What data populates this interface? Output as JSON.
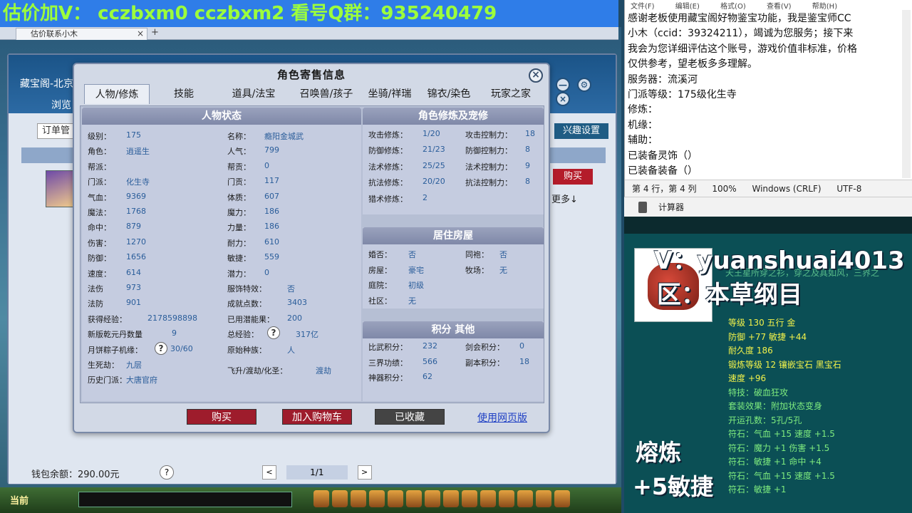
{
  "banner": {
    "text": "估价加V：  cczbxm0   cczbxm2   看号Q群：935240479"
  },
  "browser": {
    "tab_label": "估价联系小木",
    "close_glyph": "×",
    "add_glyph": "+"
  },
  "bg_window": {
    "title": "藏宝阁-北京",
    "browse": "浏览",
    "order_btn": "订单管",
    "interest_btn": "兴趣设置",
    "buy_btn": "购买",
    "more_btn": "更多↓",
    "wallet": "钱包余额：290.00元",
    "help": "?",
    "pager": {
      "prev": "<",
      "page": "1/1",
      "next": ">"
    },
    "ctrl": {
      "minimize": "—",
      "settings": "⚙",
      "close": "×"
    }
  },
  "taskbar": {
    "current": "当前"
  },
  "dialog": {
    "title": "角色寄售信息",
    "close": "×",
    "tabs": [
      "人物/修炼",
      "技能",
      "道具/法宝",
      "召唤兽/孩子",
      "坐骑/祥瑞",
      "锦衣/染色",
      "玩家之家"
    ],
    "sections": {
      "status": "人物状态",
      "cultivation": "角色修炼及宠修",
      "housing": "居住房屋",
      "points": "积分 其他"
    },
    "status_left": [
      {
        "k": "级别：",
        "v": "175"
      },
      {
        "k": "角色：",
        "v": "逍遥生"
      },
      {
        "k": "帮派：",
        "v": ""
      },
      {
        "k": "门派：",
        "v": "化生寺"
      },
      {
        "k": "气血：",
        "v": "9369"
      },
      {
        "k": "魔法：",
        "v": "1768"
      },
      {
        "k": "命中：",
        "v": "879"
      },
      {
        "k": "伤害：",
        "v": "1270"
      },
      {
        "k": "防御：",
        "v": "1656"
      },
      {
        "k": "速度：",
        "v": "614"
      },
      {
        "k": "法伤",
        "v": "973"
      },
      {
        "k": "法防",
        "v": "901"
      },
      {
        "k": "获得经验：",
        "v": "2178598898"
      },
      {
        "k": "新版乾元丹数量",
        "v": "9"
      },
      {
        "k": "月饼粽子机缘：",
        "v": "30/60"
      },
      {
        "k": "生死劫：",
        "v": "九层"
      },
      {
        "k": "历史门派：",
        "v": "大唐官府"
      }
    ],
    "status_right": [
      {
        "k": "名称：",
        "v": "瘾阳金城武"
      },
      {
        "k": "人气：",
        "v": "799"
      },
      {
        "k": "帮贡：",
        "v": "0"
      },
      {
        "k": "门贡：",
        "v": "117"
      },
      {
        "k": "体质：",
        "v": "607"
      },
      {
        "k": "魔力：",
        "v": "186"
      },
      {
        "k": "力量：",
        "v": "186"
      },
      {
        "k": "耐力：",
        "v": "610"
      },
      {
        "k": "敏捷：",
        "v": "559"
      },
      {
        "k": "潜力：",
        "v": "0"
      },
      {
        "k": "服饰特效：",
        "v": "否"
      },
      {
        "k": "成就点数：",
        "v": "3403"
      },
      {
        "k": "已用潜能果：",
        "v": "200"
      },
      {
        "k": "总经验：",
        "v": "317亿"
      },
      {
        "k": "原始种族：",
        "v": "人"
      },
      {
        "k": "飞升/渡劫/化圣：",
        "v": "渡劫"
      }
    ],
    "question": "?",
    "cultivation_left": [
      {
        "k": "攻击修炼：",
        "v": "1/20"
      },
      {
        "k": "防御修炼：",
        "v": "21/23"
      },
      {
        "k": "法术修炼：",
        "v": "25/25"
      },
      {
        "k": "抗法修炼：",
        "v": "20/20"
      },
      {
        "k": "猎术修炼：",
        "v": "2"
      }
    ],
    "cultivation_right": [
      {
        "k": "攻击控制力：",
        "v": "18"
      },
      {
        "k": "防御控制力：",
        "v": "8"
      },
      {
        "k": "法术控制力：",
        "v": "9"
      },
      {
        "k": "抗法控制力：",
        "v": "8"
      }
    ],
    "housing_left": [
      {
        "k": "婚否：",
        "v": "否"
      },
      {
        "k": "房屋：",
        "v": "豪宅"
      },
      {
        "k": "庭院：",
        "v": "初级"
      },
      {
        "k": "社区：",
        "v": "无"
      }
    ],
    "housing_right": [
      {
        "k": "同袍：",
        "v": "否"
      },
      {
        "k": "牧场：",
        "v": "无"
      }
    ],
    "points_left": [
      {
        "k": "比武积分：",
        "v": "232"
      },
      {
        "k": "三界功绩：",
        "v": "566"
      },
      {
        "k": "神器积分：",
        "v": "62"
      }
    ],
    "points_right": [
      {
        "k": "剑会积分：",
        "v": "0"
      },
      {
        "k": "副本积分：",
        "v": "18"
      }
    ],
    "buttons": {
      "buy": "购买",
      "cart": "加入购物车",
      "saved": "已收藏",
      "web": "使用网页版"
    }
  },
  "notepad": {
    "menu": [
      "文件(F)",
      "编辑(E)",
      "格式(O)",
      "查看(V)",
      "帮助(H)"
    ],
    "lines": [
      "感谢老板使用藏宝阁好物鉴宝功能，我是鉴宝师CC",
      "小木（ccid：39324211），竭诚为您服务；接下来",
      "我会为您详细评估这个账号，游戏价值非标准，价格",
      "仅供参考，望老板多多理解。",
      "服务器：流溪河",
      "门派等级：175级化生寺",
      "修炼：",
      "机缘：",
      "辅助：",
      "已装备灵饰（）",
      "已装备装备（）"
    ],
    "status": [
      "第 4 行，第 4 列",
      "100%",
      "Windows (CRLF)",
      "UTF-8"
    ]
  },
  "calculator": {
    "label": "计算器"
  },
  "item": {
    "overlay_v": "V：yuanshuai4013",
    "overlay_zone": "区：本草纲目",
    "desc": "天王星所穿之衫，穿之及其如风，三界之",
    "stats": [
      "等级 130  五行 金",
      "",
      "防御 +77 敏捷 +44",
      "耐久度 186",
      "锻炼等级 12  镶嵌宝石 黑宝石",
      "速度 +96",
      "特技：破血狂攻",
      "套装效果：附加状态变身",
      "开运孔数：5孔/5孔",
      "符石：气血 +15 速度 +1.5",
      "符石：魔力 +1 伤害 +1.5",
      "符石：敏捷 +1 命中 +4",
      "符石：气血 +15 速度 +1.5",
      "符石：敏捷 +1"
    ],
    "overlay_smelt": "熔炼",
    "overlay_agility": "+5敏捷"
  }
}
